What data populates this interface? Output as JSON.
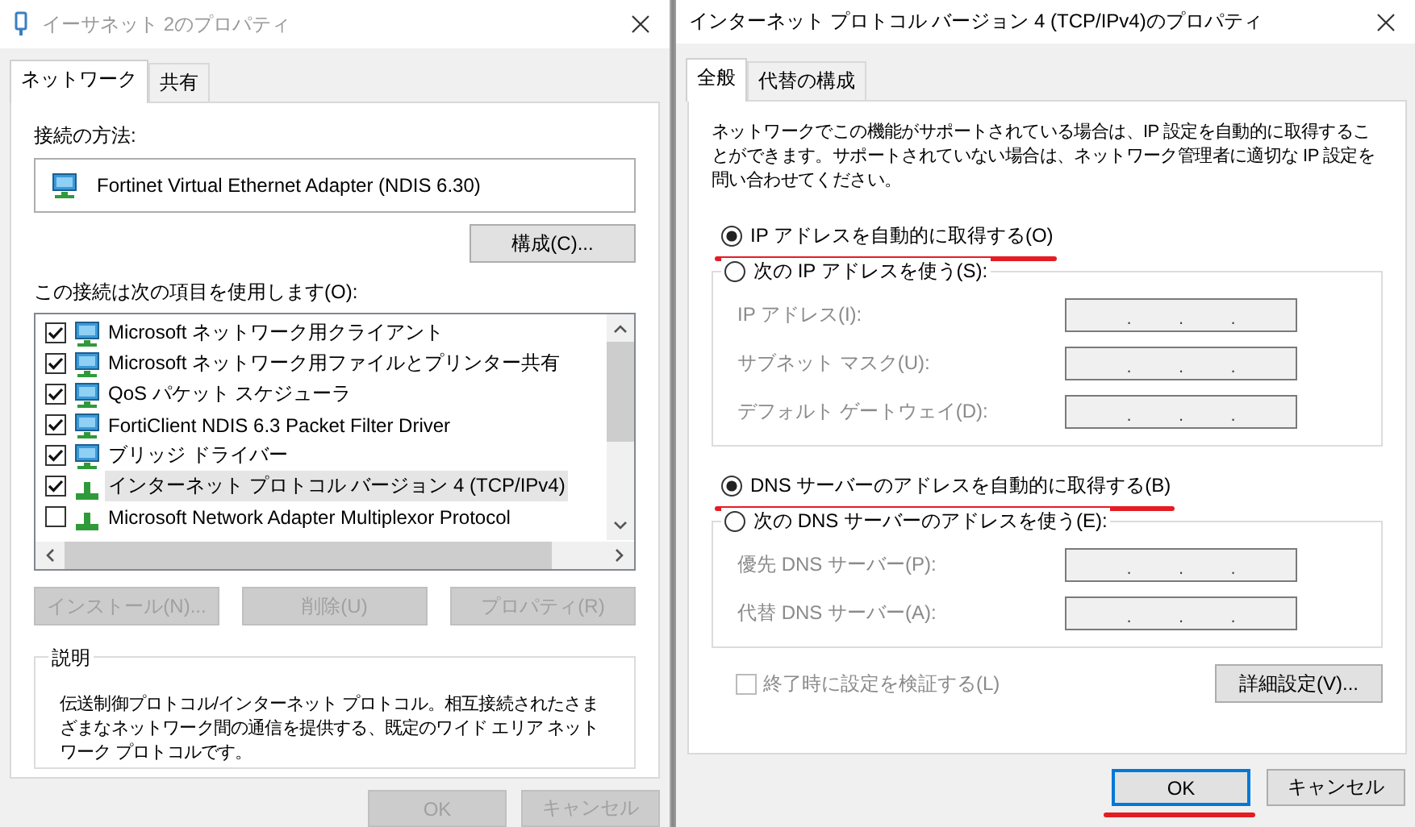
{
  "left_window": {
    "title": "イーサネット 2のプロパティ",
    "tabs": [
      {
        "label": "ネットワーク",
        "selected": true
      },
      {
        "label": "共有",
        "selected": false
      }
    ],
    "connect_using_label": "接続の方法:",
    "adapter_name": "Fortinet Virtual Ethernet Adapter (NDIS 6.30)",
    "configure_button": "構成(C)...",
    "items_label": "この接続は次の項目を使用します(O):",
    "components": [
      {
        "label": "Microsoft ネットワーク用クライアント",
        "checked": true,
        "selected": false,
        "kind": "adapter"
      },
      {
        "label": "Microsoft ネットワーク用ファイルとプリンター共有",
        "checked": true,
        "selected": false,
        "kind": "adapter"
      },
      {
        "label": "QoS パケット スケジューラ",
        "checked": true,
        "selected": false,
        "kind": "adapter"
      },
      {
        "label": "FortiClient NDIS 6.3 Packet Filter Driver",
        "checked": true,
        "selected": false,
        "kind": "adapter"
      },
      {
        "label": "ブリッジ ドライバー",
        "checked": true,
        "selected": false,
        "kind": "adapter"
      },
      {
        "label": "インターネット プロトコル バージョン 4 (TCP/IPv4)",
        "checked": true,
        "selected": true,
        "kind": "protocol"
      },
      {
        "label": "Microsoft Network Adapter Multiplexor Protocol",
        "checked": false,
        "selected": false,
        "kind": "protocol"
      }
    ],
    "action_buttons": [
      {
        "label": "インストール(N)...",
        "disabled": true
      },
      {
        "label": "削除(U)",
        "disabled": true
      },
      {
        "label": "プロパティ(R)",
        "disabled": true
      }
    ],
    "description": {
      "legend": "説明",
      "text": "伝送制御プロトコル/インターネット プロトコル。相互接続されたさまざまなネットワーク間の通信を提供する、既定のワイド エリア ネットワーク プロトコルです。"
    },
    "footer_buttons": [
      {
        "label": "OK",
        "disabled": true
      },
      {
        "label": "キャンセル",
        "disabled": true
      }
    ]
  },
  "right_window": {
    "title": "インターネット プロトコル バージョン 4 (TCP/IPv4)のプロパティ",
    "tabs": [
      {
        "label": "全般",
        "selected": true
      },
      {
        "label": "代替の構成",
        "selected": false
      }
    ],
    "intro": "ネットワークでこの機能がサポートされている場合は、IP 設定を自動的に取得することができます。サポートされていない場合は、ネットワーク管理者に適切な IP 設定を問い合わせてください。",
    "ip_auto": {
      "label": "IP アドレスを自動的に取得する(O)",
      "selected": true,
      "underlined": true
    },
    "ip_manual": {
      "label": "次の IP アドレスを使う(S):",
      "selected": false,
      "underlined": false
    },
    "ip_fields": [
      {
        "label": "IP アドレス(I):",
        "dots": [
          ".",
          ".",
          "."
        ]
      },
      {
        "label": "サブネット マスク(U):",
        "dots": [
          ".",
          ".",
          "."
        ]
      },
      {
        "label": "デフォルト ゲートウェイ(D):",
        "dots": [
          ".",
          ".",
          "."
        ]
      }
    ],
    "dns_auto": {
      "label": "DNS サーバーのアドレスを自動的に取得する(B)",
      "selected": true,
      "underlined": true
    },
    "dns_manual": {
      "label": "次の DNS サーバーのアドレスを使う(E):",
      "selected": false,
      "underlined": false
    },
    "dns_fields": [
      {
        "label": "優先 DNS サーバー(P):",
        "dots": [
          ".",
          ".",
          "."
        ]
      },
      {
        "label": "代替 DNS サーバー(A):",
        "dots": [
          ".",
          ".",
          "."
        ]
      }
    ],
    "validate": {
      "label": "終了時に設定を検証する(L)",
      "checked": false,
      "disabled": true
    },
    "advanced_button": "詳細設定(V)...",
    "footer_buttons": [
      {
        "label": "OK",
        "default": true,
        "underlined": true
      },
      {
        "label": "キャンセル",
        "default": false,
        "underlined": false
      }
    ]
  }
}
